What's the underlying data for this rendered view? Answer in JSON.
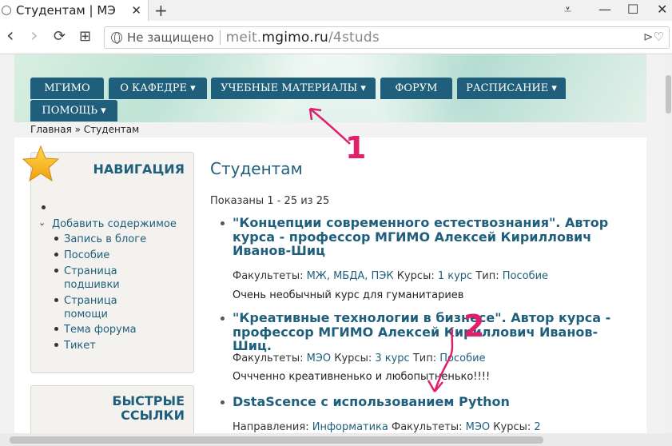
{
  "browser": {
    "tab_title": "Студентам | МЭ",
    "tab_close": "✕",
    "new_tab": "+",
    "window_controls": [
      "⩡",
      "—",
      "☐",
      "✕"
    ],
    "nav": {
      "back": "‹",
      "forward": "›",
      "reload": "⟳",
      "grid": "⊞"
    },
    "insecure_label": "Не защищено",
    "url_prefix": "meit.",
    "url_domain": "mgimo.ru",
    "url_path": "/4studs",
    "url_right_icons": "⊳♡"
  },
  "menu": {
    "items": [
      {
        "label": "МГИМО"
      },
      {
        "label": "О КАФЕДРЕ ▾"
      },
      {
        "label": "УЧЕБНЫЕ МАТЕРИАЛЫ ▾"
      },
      {
        "label": "ФОРУМ"
      },
      {
        "label": "РАСПИСАНИЕ ▾"
      },
      {
        "label": "ПОМОЩЬ ▾"
      }
    ],
    "accent": "#1f5f7c"
  },
  "breadcrumb": "Главная » Студентам",
  "sidebar": {
    "nav_title": "НАВИГАЦИЯ",
    "add_content": "Добавить содержимое",
    "sub_items": [
      "Запись в блоге",
      "Пособие",
      "Страница\nподшивки",
      "Страница\nпомощи",
      "Тема форума",
      "Тикет"
    ],
    "quick_links_title": "БЫСТРЫЕ\nССЫЛКИ"
  },
  "main": {
    "title": "Студентам",
    "shown": "Показаны 1 - 25 из 25",
    "items": [
      {
        "title": "\"Концепции современного естествознания\". Автор курса - профессор МГИМО Алексей Кириллович Иванов-Шиц",
        "fac_label": "Факультеты: ",
        "fac_values": "МЖ, МБДА, ПЭК",
        "course_label": " Курсы: ",
        "course_value": "1 курс",
        "type_label": " Тип: ",
        "type_value": "Пособие",
        "desc": "Очень необычный курс для гуманитариев"
      },
      {
        "title": "\"Креативные технологии в бизнесе\". Автор курса - профессор МГИМО Алексей Кириллович Иванов-Шиц.",
        "fac_label": "Факультеты: ",
        "fac_values": "МЭО",
        "course_label": " Курсы: ",
        "course_value": "3 курс",
        "type_label": " Тип: ",
        "type_value": "Пособие",
        "desc": "Оччченно креативненько и любопытненько!!!!"
      },
      {
        "title": "DstaScence с использованием Python",
        "dir_label": "Направления: ",
        "dir_value": "Информатика",
        "fac_label": " Факультеты: ",
        "fac_values": "МЭО",
        "course_label": " Курсы: ",
        "course_value": "2"
      }
    ]
  },
  "annotations": {
    "one": "1",
    "two": "2",
    "color": "#e0206a"
  }
}
